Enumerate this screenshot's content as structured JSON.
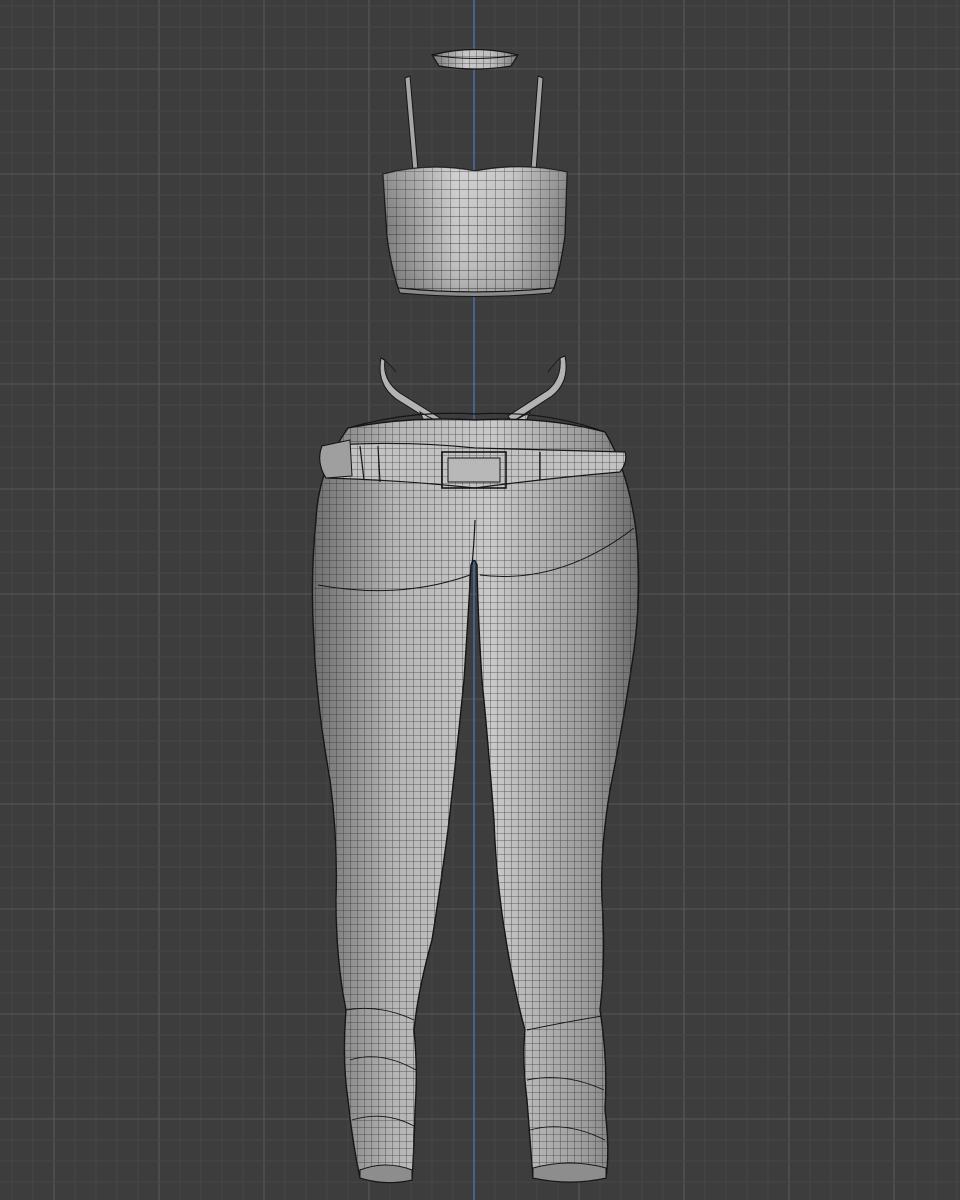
{
  "viewport": {
    "view": "front-orthographic",
    "shading": "solid-wireframe",
    "colors": {
      "background": "#3d3d3d",
      "grid_minor": "#474747",
      "grid_major": "#585858",
      "z_axis": "#4f76c2",
      "mesh_fill": "#a9a9a9",
      "mesh_light": "#d0d0d0",
      "mesh_dark": "#6e6e6e",
      "wire": "#2c2c2c",
      "outline": "#151515"
    }
  },
  "scene_objects": [
    {
      "id": "choker",
      "name": "choker-mesh"
    },
    {
      "id": "top",
      "name": "crop-top-mesh"
    },
    {
      "id": "harness",
      "name": "harness-strap-mesh"
    },
    {
      "id": "pants",
      "name": "pants-mesh"
    },
    {
      "id": "belt",
      "name": "belt-mesh"
    }
  ]
}
